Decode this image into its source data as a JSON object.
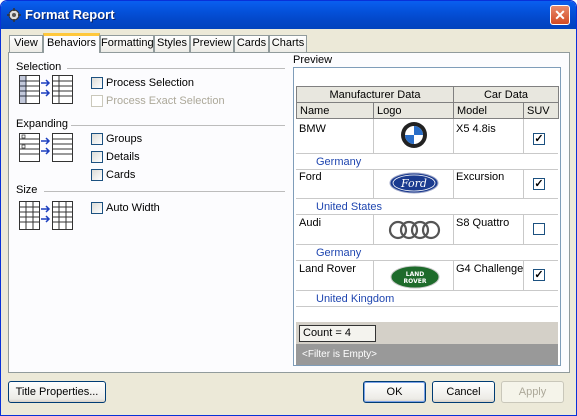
{
  "window": {
    "title": "Format Report"
  },
  "tabs": [
    "View",
    "Behaviors",
    "Formatting",
    "Styles",
    "Preview",
    "Cards",
    "Charts"
  ],
  "active_tab": "Behaviors",
  "sections": {
    "selection": {
      "label": "Selection",
      "options": [
        {
          "label": "Process Selection",
          "checked": false,
          "enabled": true
        },
        {
          "label": "Process Exact Selection",
          "checked": false,
          "enabled": false
        }
      ]
    },
    "expanding": {
      "label": "Expanding",
      "options": [
        {
          "label": "Groups",
          "checked": false,
          "enabled": true
        },
        {
          "label": "Details",
          "checked": false,
          "enabled": true
        },
        {
          "label": "Cards",
          "checked": false,
          "enabled": true
        }
      ]
    },
    "size": {
      "label": "Size",
      "options": [
        {
          "label": "Auto Width",
          "checked": false,
          "enabled": true
        }
      ]
    }
  },
  "preview": {
    "label": "Preview",
    "band_headers": [
      "Manufacturer Data",
      "Car Data"
    ],
    "columns": [
      "Name",
      "Logo",
      "Model",
      "SUV"
    ],
    "rows": [
      {
        "name": "BMW",
        "logo": "bmw-logo",
        "model": "X5 4.8is",
        "suv": true,
        "group": "Germany"
      },
      {
        "name": "Ford",
        "logo": "ford-logo",
        "model": "Excursion",
        "suv": true,
        "group": "United States"
      },
      {
        "name": "Audi",
        "logo": "audi-logo",
        "model": "S8 Quattro",
        "suv": false,
        "group": "Germany"
      },
      {
        "name": "Land Rover",
        "logo": "land-rover-logo",
        "model": "G4 Challenge",
        "suv": true,
        "group": "United Kingdom"
      }
    ],
    "count": "Count = 4",
    "filter": "<Filter is Empty>"
  },
  "buttons": {
    "title_properties": "Title Properties...",
    "ok": "OK",
    "cancel": "Cancel",
    "apply": "Apply"
  }
}
